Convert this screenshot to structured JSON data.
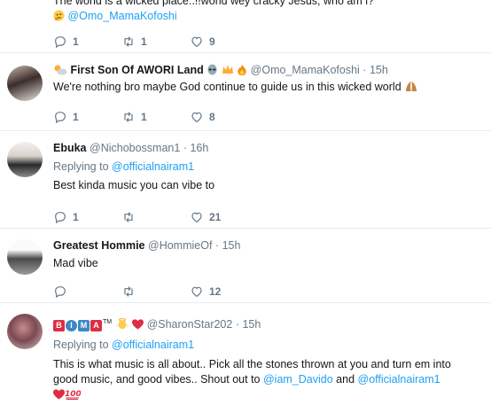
{
  "tweets": [
    {
      "partial_text": "The world is a wicked place..!!world wey cracky Jesus, who am i?",
      "mention": "@Omo_MamaKofoshi",
      "replies": "1",
      "retweets": "1",
      "likes": "9"
    },
    {
      "name": "First Son Of AWORI Land",
      "handle": "@Omo_MamaKofoshi",
      "time": "15h",
      "text": "We're nothing bro maybe God continue to guide us in this wicked world",
      "replies": "1",
      "retweets": "1",
      "likes": "8"
    },
    {
      "name": "Ebuka",
      "handle": "@Nichobossman1",
      "time": "16h",
      "replying_label": "Replying to",
      "replying_to": "@officialnairam1",
      "text": "Best kinda music you can vibe to",
      "replies": "1",
      "retweets": "",
      "likes": "21"
    },
    {
      "name": "Greatest Hommie",
      "handle": "@HommieOf",
      "time": "15h",
      "text": "Mad vibe",
      "replies": "",
      "retweets": "",
      "likes": "12"
    },
    {
      "name_letters": [
        "B",
        "I",
        "M",
        "A"
      ],
      "name_suffix": "TM",
      "handle": "@SharonStar202",
      "time": "15h",
      "replying_label": "Replying to",
      "replying_to": "@officialnairam1",
      "text_line1": "This is what music is all about.. Pick all the stones thrown at you and turn em into",
      "text_line2_a": "good music, and  good vibes.. Shout out to",
      "mention_1": "@iam_Davido",
      "text_line2_b": "and",
      "mention_2": "@officialnairam1"
    }
  ],
  "dot": "·",
  "colors": {
    "link": "#1da1f2",
    "muted": "#657786",
    "divider": "#e6ecf0"
  },
  "icons": [
    "reply-icon",
    "retweet-icon",
    "like-icon"
  ]
}
